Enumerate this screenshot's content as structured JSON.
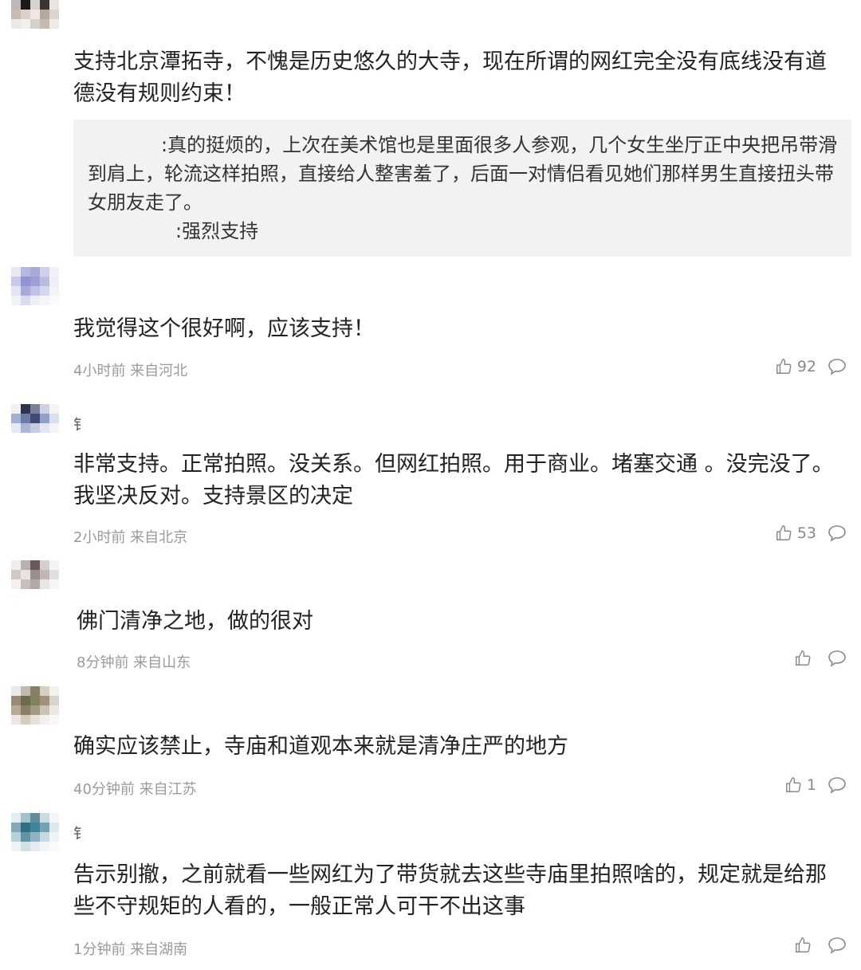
{
  "comments": [
    {
      "text": "支持北京潭拓寺，不愧是历史悠久的大寺，现在所谓的网红完全没有底线没有道德没有规则约束！",
      "replies": [
        {
          "text": ":真的挺烦的，上次在美术馆也是里面很多人参观，几个女生坐厅正中央把吊带滑到肩上，轮流这样拍照，直接给人整害羞了，后面一对情侣看见她们那样男生直接扭头带女朋友走了。"
        },
        {
          "text": ":强烈支持"
        }
      ]
    },
    {
      "text": "我觉得这个很好啊，应该支持！",
      "meta": "4小时前 来自河北",
      "likes": "92"
    },
    {
      "name_fragment": "钅",
      "text": "非常支持。正常拍照。没关系。但网红拍照。用于商业。堵塞交通 。没完没了。我坚决反对。支持景区的决定",
      "meta": "2小时前 来自北京",
      "likes": "53"
    },
    {
      "text": "佛门清净之地，做的很对",
      "meta": "8分钟前 来自山东",
      "likes": ""
    },
    {
      "text": "确实应该禁止，寺庙和道观本来就是清净庄严的地方",
      "meta": "40分钟前 来自江苏",
      "likes": "1"
    },
    {
      "name_fragment": "钅",
      "text": "告示别撤，之前就看一些网红为了带货就去这些寺庙里拍照啥的，规定就是给那些不守规矩的人看的，一般正常人可干不出这事",
      "meta": "1分钟前 来自湖南",
      "likes": ""
    }
  ],
  "icons": {
    "like": "thumbs-up-icon",
    "reply": "speech-bubble-icon"
  },
  "colors": {
    "text": "#222222",
    "meta": "#9a9a9a",
    "reply_bg": "#f2f2f2"
  }
}
